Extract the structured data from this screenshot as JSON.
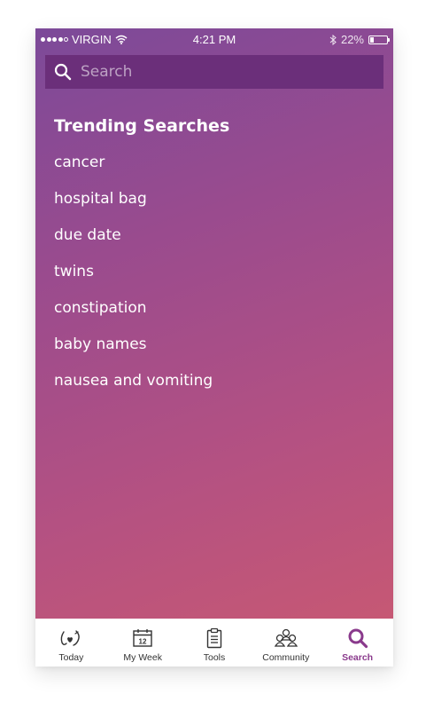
{
  "status_bar": {
    "carrier": "VIRGIN",
    "time": "4:21 PM",
    "battery": "22%",
    "battery_level": 0.22,
    "signal_bars_filled": 4,
    "signal_bars_total": 5
  },
  "search": {
    "placeholder": "Search",
    "value": ""
  },
  "trending": {
    "title": "Trending Searches",
    "items": [
      "cancer",
      "hospital bag",
      "due date",
      "twins",
      "constipation",
      "baby names",
      "nausea and vomiting"
    ]
  },
  "tab_bar": {
    "tabs": [
      {
        "label": "Today",
        "icon": "baby-feet-icon"
      },
      {
        "label": "My Week",
        "icon": "calendar-icon",
        "day": "12"
      },
      {
        "label": "Tools",
        "icon": "clipboard-icon"
      },
      {
        "label": "Community",
        "icon": "community-icon"
      },
      {
        "label": "Search",
        "icon": "search-icon"
      }
    ],
    "active": "Search"
  },
  "colors": {
    "gradient_start": "#7c4a99",
    "gradient_end": "#c65874",
    "search_bar_bg": "#6b2f7a",
    "active_tab": "#8a3a8c"
  }
}
